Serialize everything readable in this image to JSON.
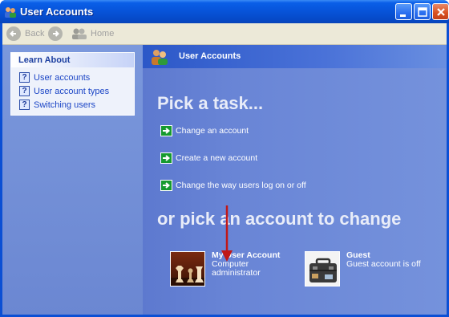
{
  "window": {
    "title": "User Accounts"
  },
  "toolbar": {
    "back_label": "Back",
    "home_label": "Home"
  },
  "sidebar": {
    "learn_about_title": "Learn About",
    "items": [
      {
        "label": "User accounts",
        "icon": "help-icon"
      },
      {
        "label": "User account types",
        "icon": "help-icon"
      },
      {
        "label": "Switching users",
        "icon": "help-icon"
      }
    ]
  },
  "main": {
    "header_title": "User Accounts",
    "pick_task_heading": "Pick a task...",
    "tasks": [
      {
        "label": "Change an account",
        "icon": "green-arrow-icon"
      },
      {
        "label": "Create a new account",
        "icon": "green-arrow-icon"
      },
      {
        "label": "Change the way users log on or off",
        "icon": "green-arrow-icon"
      }
    ],
    "pick_account_heading": "or pick an account to change",
    "accounts": [
      {
        "name": "My User Account",
        "line1": "Computer",
        "line2": "administrator",
        "picture": "chess-pieces"
      },
      {
        "name": "Guest",
        "line1": "Guest account is off",
        "line2": "",
        "picture": "briefcase"
      }
    ]
  },
  "colors": {
    "titlebar": "#0753d8",
    "content_background": "#6e8fd6",
    "task_icon_green": "#169a2e",
    "annotation_arrow": "#c01818"
  }
}
